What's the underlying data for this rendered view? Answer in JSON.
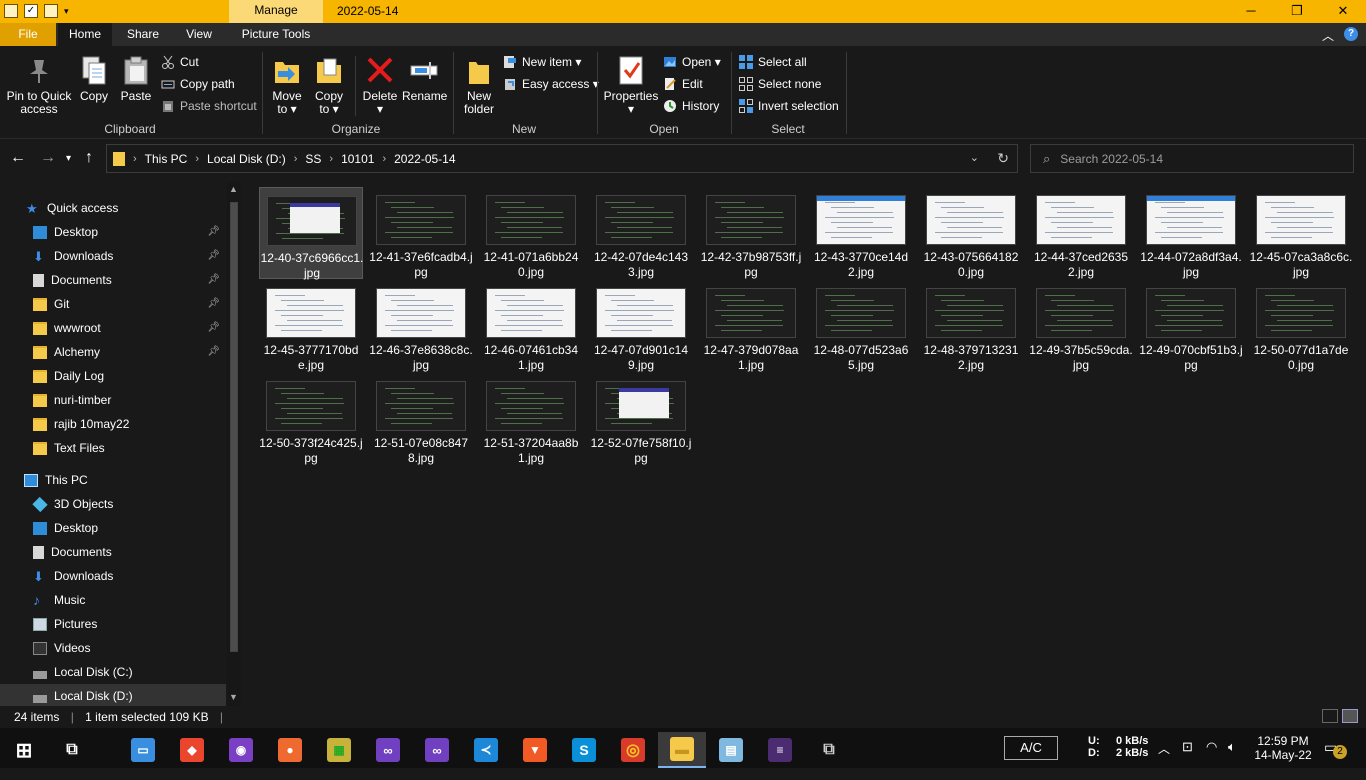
{
  "window": {
    "title": "2022-05-14",
    "context_tab": "Manage",
    "controls": {
      "minimize": "─",
      "maximize": "❐",
      "close": "✕"
    }
  },
  "ribbon_tabs": [
    "File",
    "Home",
    "Share",
    "View",
    "Picture Tools"
  ],
  "ribbon": {
    "clipboard": {
      "label": "Clipboard",
      "pin": "Pin to Quick\naccess",
      "copy": "Copy",
      "paste": "Paste",
      "cut": "Cut",
      "copy_path": "Copy path",
      "paste_shortcut": "Paste shortcut"
    },
    "organize": {
      "label": "Organize",
      "move_to": "Move\nto ▾",
      "copy_to": "Copy\nto ▾",
      "delete": "Delete\n▾",
      "rename": "Rename"
    },
    "new": {
      "label": "New",
      "new_folder": "New\nfolder",
      "new_item": "New item ▾",
      "easy_access": "Easy access ▾"
    },
    "open": {
      "label": "Open",
      "properties": "Properties\n▾",
      "open": "Open ▾",
      "edit": "Edit",
      "history": "History"
    },
    "select": {
      "label": "Select",
      "select_all": "Select all",
      "select_none": "Select none",
      "invert": "Invert selection"
    }
  },
  "address": {
    "crumbs": [
      "This PC",
      "Local Disk (D:)",
      "SS",
      "10101",
      "2022-05-14"
    ],
    "search_placeholder": "Search 2022-05-14"
  },
  "nav_pane": {
    "quick_access": "Quick access",
    "quick_items": [
      {
        "label": "Desktop",
        "pinned": true,
        "icon": "desktop-icon"
      },
      {
        "label": "Downloads",
        "pinned": true,
        "icon": "download-icon"
      },
      {
        "label": "Documents",
        "pinned": true,
        "icon": "documents-icon"
      },
      {
        "label": "Git",
        "pinned": true,
        "icon": "folder-icon"
      },
      {
        "label": "wwwroot",
        "pinned": true,
        "icon": "folder-icon"
      },
      {
        "label": "Alchemy",
        "pinned": true,
        "icon": "folder-icon"
      },
      {
        "label": "Daily Log",
        "pinned": false,
        "icon": "folder-icon"
      },
      {
        "label": "nuri-timber",
        "pinned": false,
        "icon": "folder-icon"
      },
      {
        "label": "rajib 10may22",
        "pinned": false,
        "icon": "folder-icon"
      },
      {
        "label": "Text Files",
        "pinned": false,
        "icon": "folder-icon"
      }
    ],
    "this_pc": "This PC",
    "pc_items": [
      {
        "label": "3D Objects",
        "icon": "3d-objects-icon"
      },
      {
        "label": "Desktop",
        "icon": "desktop-icon"
      },
      {
        "label": "Documents",
        "icon": "documents-icon"
      },
      {
        "label": "Downloads",
        "icon": "download-icon"
      },
      {
        "label": "Music",
        "icon": "music-icon"
      },
      {
        "label": "Pictures",
        "icon": "pictures-icon"
      },
      {
        "label": "Videos",
        "icon": "videos-icon"
      },
      {
        "label": "Local Disk (C:)",
        "icon": "drive-icon"
      },
      {
        "label": "Local Disk (D:)",
        "icon": "drive-icon"
      }
    ]
  },
  "files": [
    {
      "name": "12-40-37c6966cc1.jpg",
      "kind": "dark-dialog",
      "selected": true
    },
    {
      "name": "12-41-37e6fcadb4.jpg",
      "kind": "dark"
    },
    {
      "name": "12-41-071a6bb240.jpg",
      "kind": "dark"
    },
    {
      "name": "12-42-07de4c1433.jpg",
      "kind": "dark"
    },
    {
      "name": "12-42-37b98753ff.jpg",
      "kind": "dark"
    },
    {
      "name": "12-43-3770ce14d2.jpg",
      "kind": "light-blue"
    },
    {
      "name": "12-43-0756641820.jpg",
      "kind": "light"
    },
    {
      "name": "12-44-37ced26352.jpg",
      "kind": "light"
    },
    {
      "name": "12-44-072a8df3a4.jpg",
      "kind": "light-blue"
    },
    {
      "name": "12-45-07ca3a8c6c.jpg",
      "kind": "light"
    },
    {
      "name": "12-45-3777170bde.jpg",
      "kind": "light"
    },
    {
      "name": "12-46-37e8638c8c.jpg",
      "kind": "light"
    },
    {
      "name": "12-46-07461cb341.jpg",
      "kind": "light"
    },
    {
      "name": "12-47-07d901c149.jpg",
      "kind": "light"
    },
    {
      "name": "12-47-379d078aa1.jpg",
      "kind": "dark"
    },
    {
      "name": "12-48-077d523a65.jpg",
      "kind": "dark"
    },
    {
      "name": "12-48-3797132312.jpg",
      "kind": "dark"
    },
    {
      "name": "12-49-37b5c59cda.jpg",
      "kind": "dark"
    },
    {
      "name": "12-49-070cbf51b3.jpg",
      "kind": "dark"
    },
    {
      "name": "12-50-077d1a7de0.jpg",
      "kind": "dark"
    },
    {
      "name": "12-50-373f24c425.jpg",
      "kind": "dark"
    },
    {
      "name": "12-51-07e08c8478.jpg",
      "kind": "dark"
    },
    {
      "name": "12-51-37204aa8b1.jpg",
      "kind": "dark"
    },
    {
      "name": "12-52-07fe758f10.jpg",
      "kind": "dark-dialog"
    }
  ],
  "status": {
    "count": "24 items",
    "selection": "1 item selected  109 KB"
  },
  "taskbar": {
    "apps": [
      {
        "name": "start",
        "icon": "windows-icon"
      },
      {
        "name": "task-view",
        "icon": "task-view-icon"
      },
      {
        "name": "this-pc",
        "icon": "computer-icon"
      },
      {
        "name": "git",
        "icon": "git-icon"
      },
      {
        "name": "github",
        "icon": "github-icon"
      },
      {
        "name": "postman",
        "icon": "postman-icon"
      },
      {
        "name": "file-zilla",
        "icon": "excel-like-icon"
      },
      {
        "name": "visual-studio",
        "icon": "visual-studio-icon"
      },
      {
        "name": "visual-studio-2",
        "icon": "visual-studio-icon"
      },
      {
        "name": "vscode",
        "icon": "vscode-icon"
      },
      {
        "name": "brave",
        "icon": "brave-icon"
      },
      {
        "name": "skype",
        "icon": "skype-icon"
      },
      {
        "name": "chrome",
        "icon": "chrome-icon"
      },
      {
        "name": "file-explorer",
        "icon": "folder-icon"
      },
      {
        "name": "notepad",
        "icon": "notepad-icon"
      },
      {
        "name": "terminal",
        "icon": "terminal-icon"
      },
      {
        "name": "remote",
        "icon": "remote-icon"
      }
    ],
    "ac": "A/C",
    "net_up_label": "U:",
    "net_down_label": "D:",
    "net_up": "0 kB/s",
    "net_down": "2 kB/s",
    "time": "12:59 PM",
    "date": "14-May-22",
    "notifications": "2"
  }
}
